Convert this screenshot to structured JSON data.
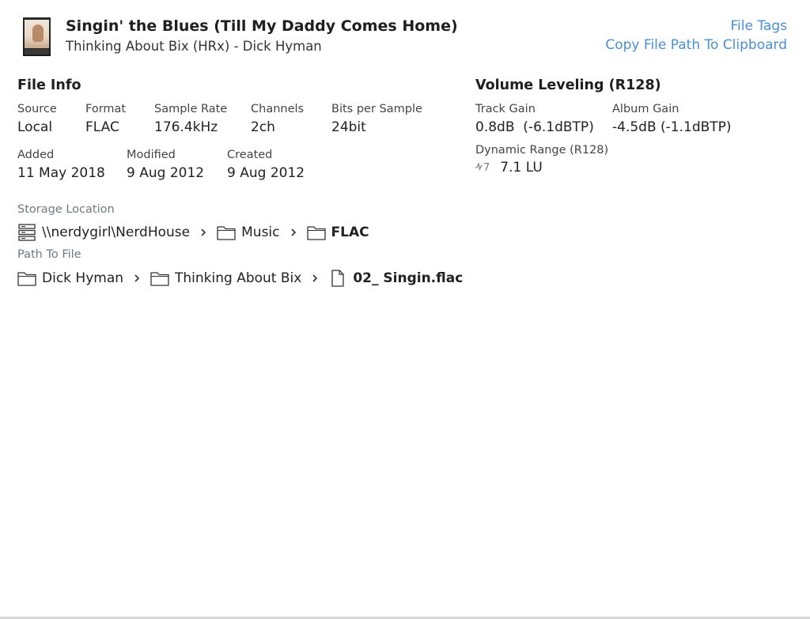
{
  "header": {
    "track_title": "Singin' the Blues (Till My Daddy Comes Home)",
    "track_subtitle": "Thinking About Bix (HRx) - Dick Hyman",
    "file_tags_link": "File Tags",
    "copy_path_link": "Copy File Path To Clipboard",
    "accent_color": "#4a8fd6"
  },
  "file_info": {
    "title": "File Info",
    "source": {
      "label": "Source",
      "value": "Local"
    },
    "format": {
      "label": "Format",
      "value": "FLAC"
    },
    "sample_rate": {
      "label": "Sample Rate",
      "value": "176.4kHz"
    },
    "channels": {
      "label": "Channels",
      "value": "2ch"
    },
    "bits_per_sample": {
      "label": "Bits per Sample",
      "value": "24bit"
    },
    "added": {
      "label": "Added",
      "value": "11 May 2018"
    },
    "modified": {
      "label": "Modified",
      "value": "9 Aug 2012"
    },
    "created": {
      "label": "Created",
      "value": "9 Aug 2012"
    }
  },
  "storage": {
    "label": "Storage Location",
    "crumbs": [
      {
        "icon": "server-icon",
        "label": "\\\\nerdygirl\\NerdHouse"
      },
      {
        "icon": "folder-icon",
        "label": "Music"
      },
      {
        "icon": "folder-icon",
        "label": "FLAC"
      }
    ]
  },
  "path_to_file": {
    "label": "Path To File",
    "crumbs": [
      {
        "icon": "folder-icon",
        "label": "Dick Hyman"
      },
      {
        "icon": "folder-icon",
        "label": "Thinking About Bix"
      },
      {
        "icon": "file-icon",
        "label": "02_ Singin.flac"
      }
    ]
  },
  "volume_leveling": {
    "title": "Volume Leveling (R128)",
    "track_gain": {
      "label": "Track Gain",
      "value": "0.8dB  (-6.1dBTP)"
    },
    "album_gain": {
      "label": "Album Gain",
      "value": "-4.5dB (-1.1dBTP)"
    },
    "dynamic_range": {
      "label": "Dynamic Range (R128)",
      "badge": "7",
      "value": "7.1 LU"
    }
  }
}
